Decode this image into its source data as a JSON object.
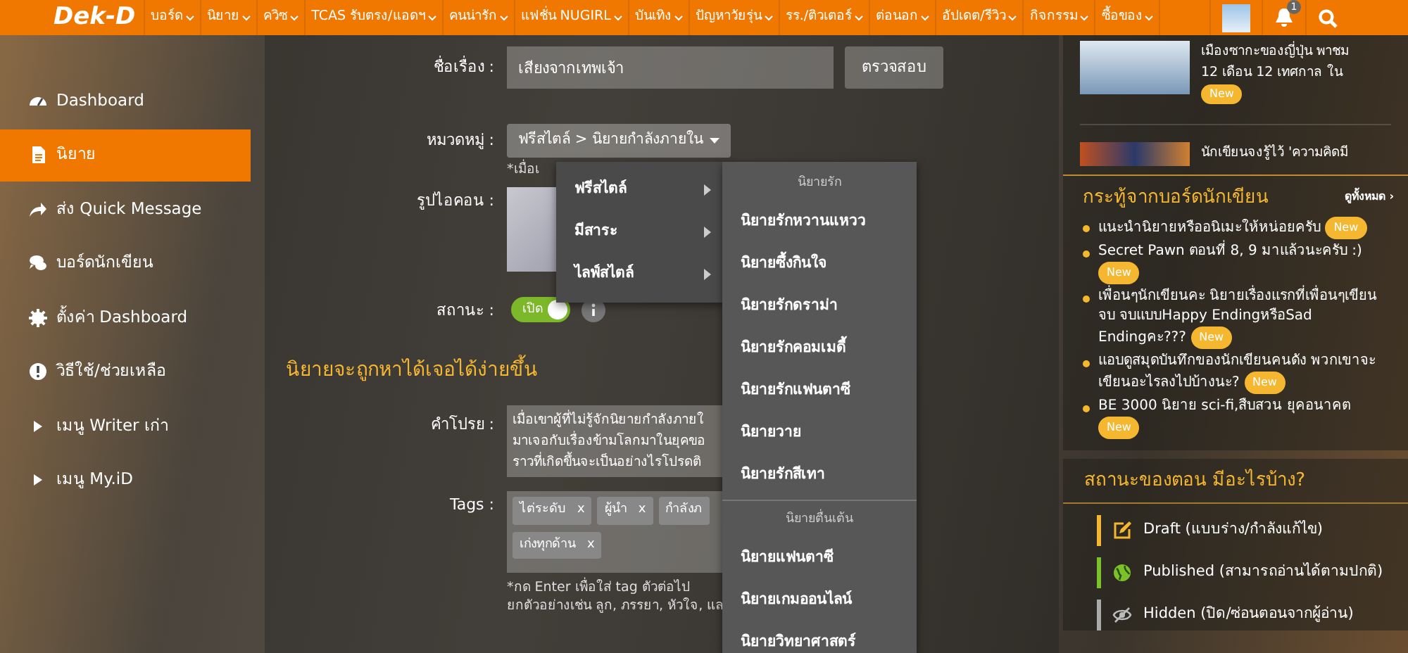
{
  "navbar": {
    "logo": "Dek-D",
    "menu": [
      {
        "label": "บอร์ด"
      },
      {
        "label": "นิยาย"
      },
      {
        "label": "ควิซ"
      },
      {
        "label": "TCAS รับตรง/แอดฯ"
      },
      {
        "label": "คนน่ารัก"
      },
      {
        "label": "แฟชั่น NUGIRL"
      },
      {
        "label": "บันเทิง"
      },
      {
        "label": "ปัญหาวัยรุ่น"
      },
      {
        "label": "รร./ติวเตอร์"
      },
      {
        "label": "ต่อนอก"
      },
      {
        "label": "อัปเดต/รีวิว"
      },
      {
        "label": "กิจกรรม"
      },
      {
        "label": "ซื้อของ"
      }
    ],
    "notification_count": "1"
  },
  "sidebar": {
    "items": [
      {
        "label": "Dashboard",
        "selected": false
      },
      {
        "label": "นิยาย",
        "selected": true
      },
      {
        "label": "ส่ง Quick Message",
        "selected": false
      },
      {
        "label": "บอร์ดนักเขียน",
        "selected": false
      },
      {
        "label": "ตั้งค่า Dashboard",
        "selected": false
      },
      {
        "label": "วิธีใช้/ช่วยเหลือ",
        "selected": false
      },
      {
        "label": "เมนู Writer เก่า",
        "selected": false
      },
      {
        "label": "เมนู My.iD",
        "selected": false
      }
    ]
  },
  "form": {
    "title": {
      "label": "ชื่อเรื่อง :",
      "value": "เสียงจากเทพเจ้า",
      "button": "ตรวจสอบ"
    },
    "category": {
      "label": "หมวดหมู่ :",
      "value": "ฟรีสไตล์ > นิยายกำลังภายใน",
      "hint": "*เมื่อเ"
    },
    "icon_image": {
      "label": "รูปไอคอน :"
    },
    "status": {
      "label": "สถานะ :",
      "on": true,
      "text": "เปิด"
    },
    "section_heading": "นิยายจะถูกหาได้เจอได้ง่ายขึ้น",
    "synopsis": {
      "label": "คำโปรย :",
      "lines": [
        "เมื่อเขาผู้ที่ไม่รู้จักนิยายกำลังภายใ",
        "มาเจอกับเรื่องข้ามโลกมาในยุคขอ",
        "ราวที่เกิดขึ้นจะเป็นอย่างไรโปรดติ"
      ]
    },
    "tags": {
      "label": "Tags :",
      "items": [
        {
          "text": "ไต่ระดับ",
          "remove": "x"
        },
        {
          "text": "ผู้นำ",
          "remove": "x"
        },
        {
          "text": "กำลังภ"
        },
        {
          "text": "เก่งทุกด้าน",
          "remove": "x"
        }
      ],
      "hint_lines": [
        "*กด Enter เพื่อใส่ tag ตัวต่อไป",
        "ยกตัวอย่างเช่น ลูก, ภรรยา, หัวใจ, แล"
      ]
    }
  },
  "category_menu": {
    "items": [
      {
        "label": "ฟรีสไตล์",
        "selected": false
      },
      {
        "label": "มีสาระ",
        "selected": false
      },
      {
        "label": "ไลฟ์สไตล์",
        "selected": false
      }
    ]
  },
  "category_submenu": {
    "groups": [
      {
        "header": "นิยายรัก",
        "items": [
          "นิยายรักหวานแหวว",
          "นิยายซึ้งกินใจ",
          "นิยายรักดราม่า",
          "นิยายรักคอมเมดี้",
          "นิยายรักแฟนตาซี",
          "นิยายวาย",
          "นิยายรักสีเทา"
        ]
      },
      {
        "header": "นิยายตื่นเต้น",
        "items": [
          "นิยายแฟนตาซี",
          "นิยายเกมออนไลน์",
          "นิยายวิทยาศาสตร์"
        ]
      }
    ]
  },
  "news": [
    {
      "lines": [
        "เมืองซากะของญี่ปุ่น พาชม",
        "12 เดือน 12 เทศกาล ใน"
      ],
      "badge": "New"
    },
    {
      "lines": [
        "นักเขียนจงรู้ไว้ 'ความคิดมี"
      ]
    }
  ],
  "board": {
    "title": "กระทู้จากบอร์ดนักเขียน",
    "more": "ดูทั้งหมด ›",
    "posts": [
      {
        "text": "แนะนำนิยายหรืออนิเมะให้หน่อยครับ",
        "badge": "New"
      },
      {
        "text": "Secret Pawn ตอนที่ 8, 9 มาแล้วนะครับ :)",
        "badge": "New"
      },
      {
        "text": "เพื่อนๆนักเขียนคะ นิยายเรื่องแรกที่เพื่อนๆเขียนจบ จบแบบHappy EndingหรือSad Endingคะ???",
        "badge": "New"
      },
      {
        "text": "แอบดูสมุดบันทึกของนักเขียนคนดัง พวกเขาจะเขียนอะไรลงไปบ้างนะ?",
        "badge": "New"
      },
      {
        "text": "BE 3000 นิยาย sci-fi,สืบสวน ยุคอนาคต",
        "badge": "New"
      }
    ]
  },
  "episode_status": {
    "title": "สถานะของตอน มีอะไรบ้าง?",
    "items": [
      {
        "label": "Draft (แบบร่าง/กำลังแก้ไข)",
        "color": "#f5b730"
      },
      {
        "label": "Published (สามารถอ่านได้ตามปกติ)",
        "color": "#7cc02a"
      },
      {
        "label": "Hidden (ปิด/ซ่อนตอนจากผู้อ่าน)",
        "color": "#aaaaaa"
      }
    ]
  }
}
